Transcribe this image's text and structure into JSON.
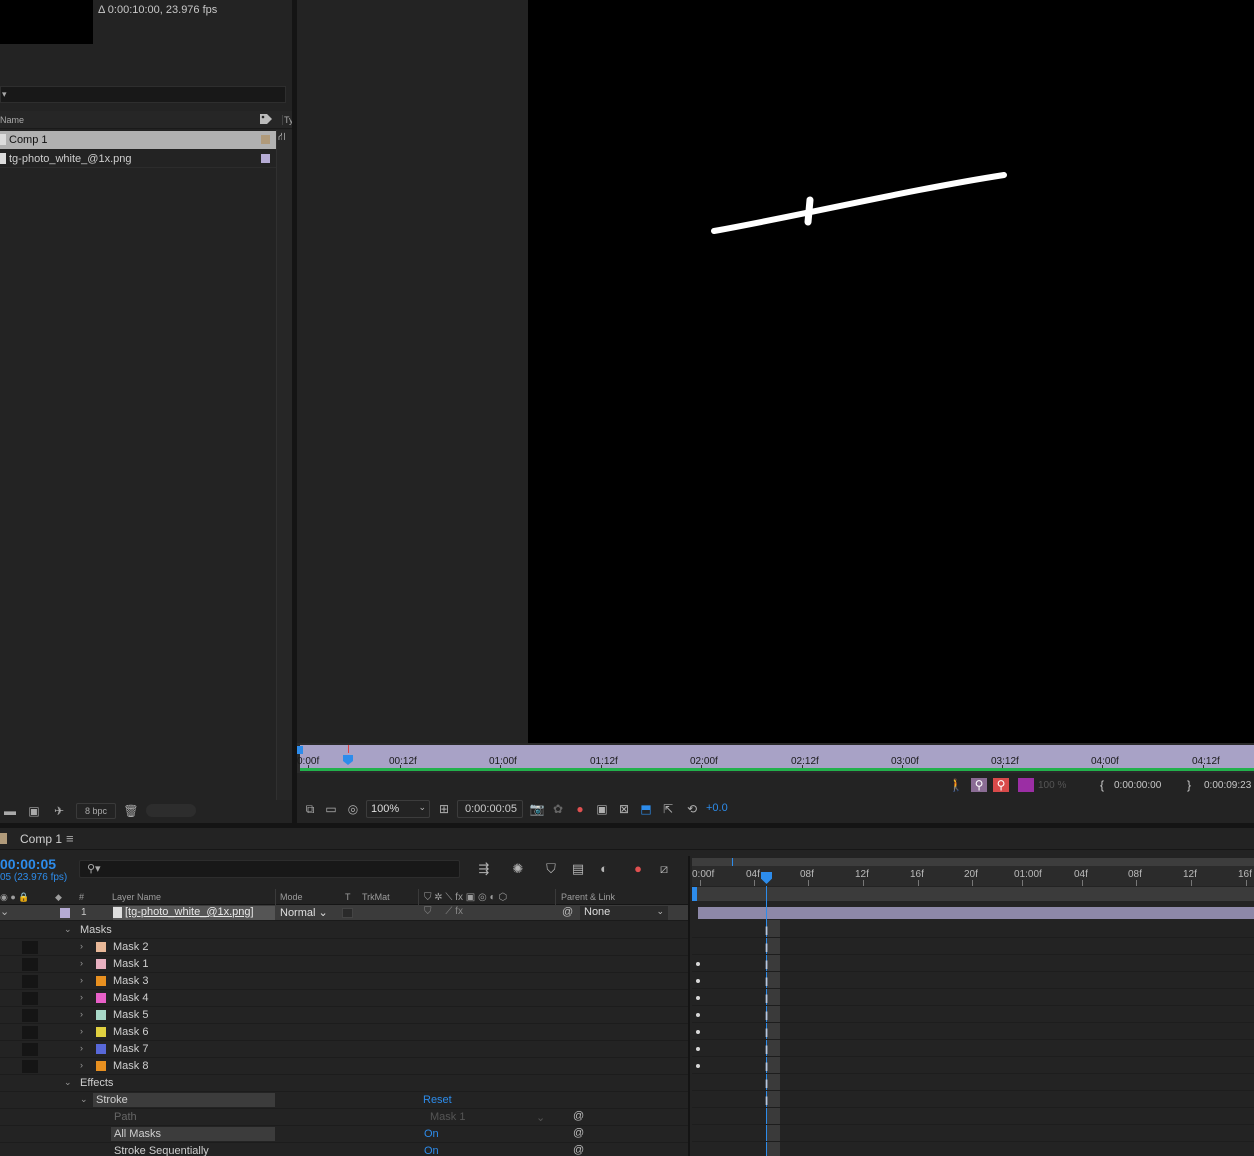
{
  "project": {
    "info": "Δ 0:00:10:00, 23.976 fps",
    "column_name": "Name",
    "column_type": "Ty",
    "items": [
      {
        "label": "Comp 1",
        "color": "#b09a7a"
      },
      {
        "label": "tg-photo_white_@1x.png",
        "color": "#b5abd4"
      }
    ],
    "bpc": "8 bpc"
  },
  "viewer": {
    "mini_ticks": [
      "0:00f",
      "00:12f",
      "01:00f",
      "01:12f",
      "02:00f",
      "02:12f",
      "03:00f",
      "03:12f",
      "04:00f",
      "04:12f"
    ],
    "resolution_percent": "100 %",
    "in_time": "0:00:00:00",
    "out_time": "0:00:09:23",
    "zoom": "100%",
    "timecode": "0:00:00:05",
    "exposure": "+0.0"
  },
  "timeline": {
    "comp_tab": "Comp 1",
    "current_time": "00:00:05",
    "fps": "05 (23.976 fps)",
    "columns": {
      "hash": "#",
      "layer_name": "Layer Name",
      "mode": "Mode",
      "t": "T",
      "trkmat": "TrkMat",
      "parent": "Parent & Link"
    },
    "layer": {
      "number": "1",
      "name": "[tg-photo_white_@1x.png]",
      "mode": "Normal",
      "parent": "None"
    },
    "groups": {
      "masks": "Masks",
      "effects": "Effects"
    },
    "masks": [
      {
        "name": "Mask 2",
        "color": "#e8b898"
      },
      {
        "name": "Mask 1",
        "color": "#e8b0c0"
      },
      {
        "name": "Mask 3",
        "color": "#e89020"
      },
      {
        "name": "Mask 4",
        "color": "#e860c8"
      },
      {
        "name": "Mask 5",
        "color": "#a8d8c8"
      },
      {
        "name": "Mask 6",
        "color": "#e0d040"
      },
      {
        "name": "Mask 7",
        "color": "#5868d8"
      },
      {
        "name": "Mask 8",
        "color": "#e89020"
      }
    ],
    "effect": {
      "name": "Stroke",
      "reset": "Reset",
      "path_label": "Path",
      "path_value": "Mask 1",
      "all_masks_label": "All Masks",
      "all_masks_value": "On",
      "stroke_seq_label": "Stroke Sequentially",
      "stroke_seq_value": "On"
    },
    "ruler_ticks": [
      "0:00f",
      "04f",
      "08f",
      "12f",
      "16f",
      "20f",
      "01:00f",
      "04f",
      "08f",
      "12f",
      "16f"
    ]
  }
}
